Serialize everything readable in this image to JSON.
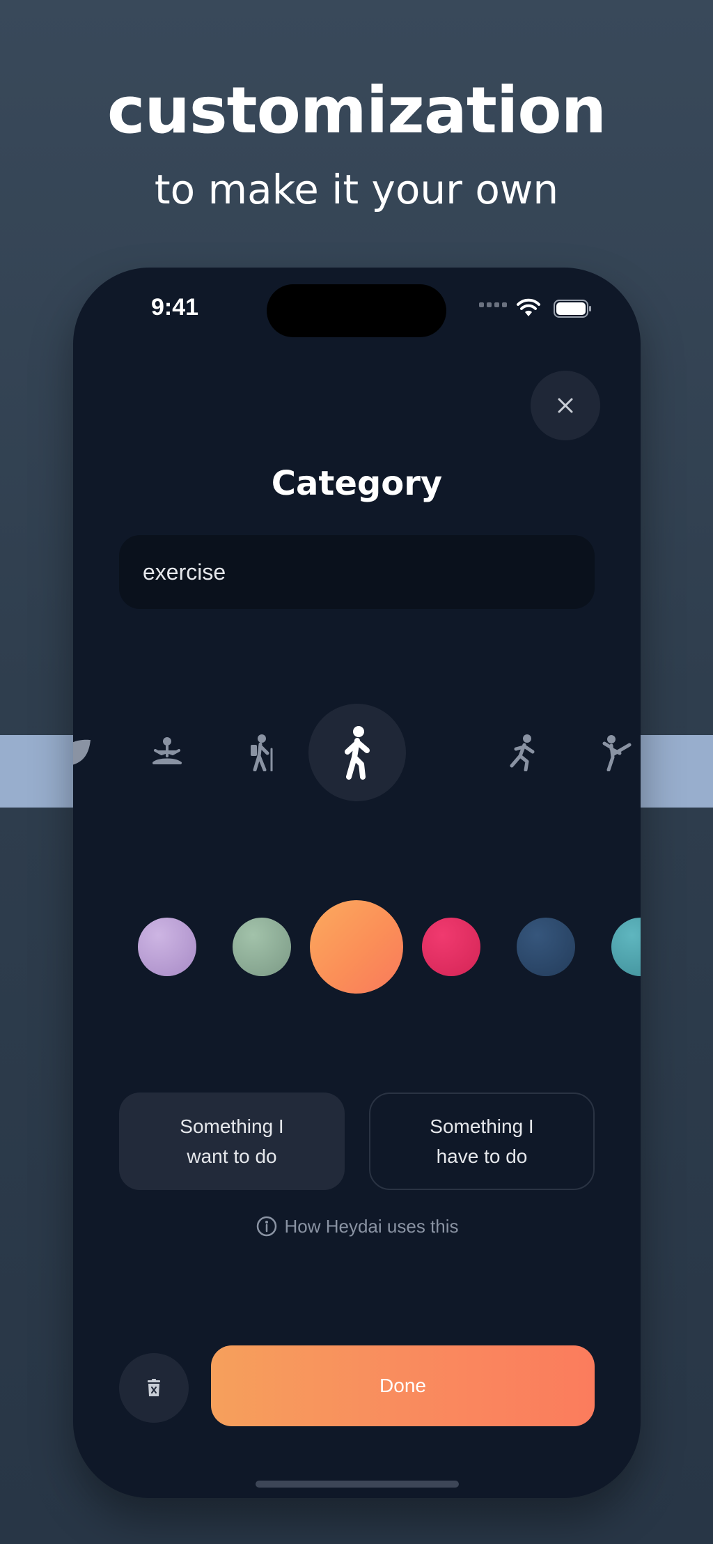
{
  "promo": {
    "headline": "customization",
    "subline": "to make it your own"
  },
  "status_bar": {
    "time": "9:41"
  },
  "screen": {
    "title": "Category",
    "name_field": {
      "value": "exercise"
    },
    "icons": [
      "leaf-icon",
      "meditation-icon",
      "hiking-icon",
      "walking-icon",
      "running-icon",
      "martial-arts-icon",
      "swimming-icon"
    ],
    "selected_icon": "walking-icon",
    "colors": [
      "#b89fd4",
      "#8fae98",
      "#fb8f58",
      "#e12d63",
      "#2c4869",
      "#4fa3ad"
    ],
    "selected_color": "#fb8f58",
    "choices": {
      "want": "Something I\nwant to do",
      "have": "Something I\nhave to do"
    },
    "info_link": "How Heydai uses this",
    "done_label": "Done"
  }
}
